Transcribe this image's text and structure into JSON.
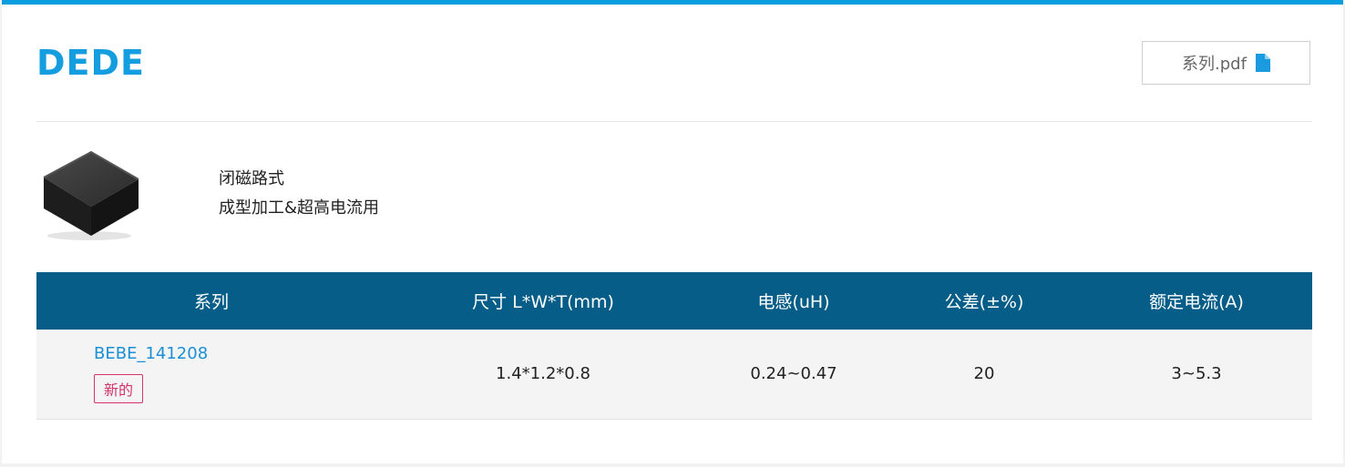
{
  "header": {
    "title": "DEDE",
    "pdf_label": "系列.pdf",
    "pdf_icon": "file-icon"
  },
  "product": {
    "image": "inductor-chip-image",
    "desc_line1": "闭磁路式",
    "desc_line2": "成型加工&超高电流用"
  },
  "table": {
    "columns": [
      "系列",
      "尺寸 L*W*T(mm)",
      "电感(uH)",
      "公差(±%)",
      "额定电流(A)"
    ],
    "rows": [
      {
        "series": "BEBE_141208",
        "badge": "新的",
        "size": "1.4*1.2*0.8",
        "inductance": "0.24~0.47",
        "tolerance": "20",
        "current": "3~5.3"
      }
    ]
  },
  "colors": {
    "accent": "#0a9ee0",
    "title": "#149ee0",
    "table_header": "#055d88",
    "badge": "#d2336b",
    "link": "#1b8fd6"
  }
}
